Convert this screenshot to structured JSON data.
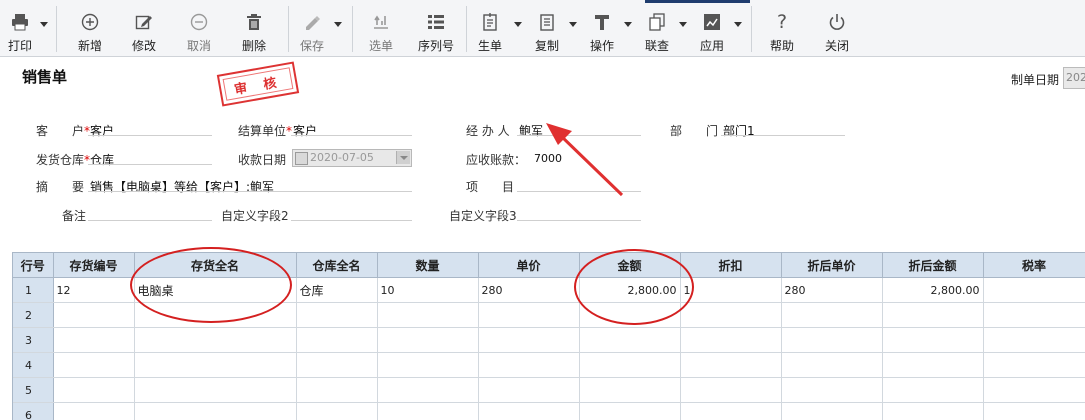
{
  "toolbar": {
    "items": [
      {
        "label": "打印",
        "icon": "printer-icon"
      },
      {
        "label": "新增",
        "icon": "add-icon"
      },
      {
        "label": "修改",
        "icon": "edit-icon"
      },
      {
        "label": "取消",
        "icon": "cancel-icon"
      },
      {
        "label": "删除",
        "icon": "trash-icon"
      },
      {
        "label": "保存",
        "icon": "save-icon"
      },
      {
        "label": "选单",
        "icon": "select-bill-icon"
      },
      {
        "label": "序列号",
        "icon": "serial-list-icon"
      },
      {
        "label": "生单",
        "icon": "generate-bill-icon"
      },
      {
        "label": "复制",
        "icon": "copy-icon"
      },
      {
        "label": "操作",
        "icon": "operation-icon"
      },
      {
        "label": "联查",
        "icon": "linked-query-icon"
      },
      {
        "label": "应用",
        "icon": "apply-icon"
      },
      {
        "label": "帮助",
        "icon": "help-icon"
      },
      {
        "label": "关闭",
        "icon": "power-icon"
      }
    ]
  },
  "form": {
    "title": "销售单",
    "stamp": "审 核",
    "create_date_label": "制单日期",
    "create_date_value": "202",
    "customer_label": "客　　户",
    "customer_value": "客户",
    "settle_label": "结算单位",
    "settle_value": "客户",
    "handler_label": "经 办 人",
    "handler_value": "鲍军",
    "dept_label": "部　　门",
    "dept_value": "部门1",
    "warehouse_label": "发货仓库",
    "warehouse_value": "仓库",
    "receipt_date_label": "收款日期",
    "receipt_date_value": "2020-07-05",
    "receivable_label": "应收账款：",
    "receivable_value": "7000",
    "summary_label": "摘　　要",
    "summary_value": "销售【电脑桌】等给【客户】:鲍军",
    "project_label": "项　　目",
    "remark_label": "备注",
    "custom2_label": "自定义字段2",
    "custom3_label": "自定义字段3"
  },
  "grid": {
    "columns": [
      "行号",
      "存货编号",
      "存货全名",
      "仓库全名",
      "数量",
      "单价",
      "金额",
      "折扣",
      "折后单价",
      "折后金额",
      "税率"
    ],
    "rows": [
      {
        "no": "1",
        "code": "12",
        "name": "电脑桌",
        "warehouse": "仓库",
        "qty": "10",
        "price": "280",
        "amount": "2,800.00",
        "discount": "1",
        "disc_price": "280",
        "disc_amount": "2,800.00",
        "tax": ""
      },
      {
        "no": "2"
      },
      {
        "no": "3"
      },
      {
        "no": "4"
      },
      {
        "no": "5"
      },
      {
        "no": "6"
      }
    ]
  },
  "colors": {
    "accent": "#d42020",
    "grid_header": "#d6e2ef"
  }
}
